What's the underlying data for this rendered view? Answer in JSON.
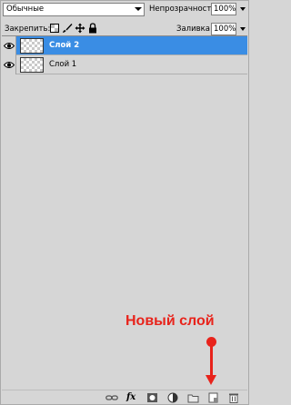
{
  "header": {
    "blend_mode": "Обычные",
    "opacity_label": "Непрозрачность:",
    "opacity_value": "100%"
  },
  "lock_row": {
    "lock_label": "Закрепить:",
    "fill_label": "Заливка:",
    "fill_value": "100%",
    "lock_icons": [
      "lock-transparent-icon",
      "lock-brush-icon",
      "lock-move-icon",
      "lock-all-icon"
    ]
  },
  "layers": [
    {
      "name": "Слой 2",
      "selected": true
    },
    {
      "name": "Слой 1",
      "selected": false
    }
  ],
  "annotation": {
    "text": "Новый слой",
    "color": "#e8231b"
  },
  "bottom_toolbar": {
    "icons": [
      "link-layers-icon",
      "fx-icon",
      "add-mask-icon",
      "adjustment-layer-icon",
      "new-group-icon",
      "new-layer-icon",
      "delete-layer-icon"
    ],
    "fx_label": "fx"
  },
  "colors": {
    "selection": "#3a8de4",
    "panel_bg": "#d6d6d6"
  }
}
